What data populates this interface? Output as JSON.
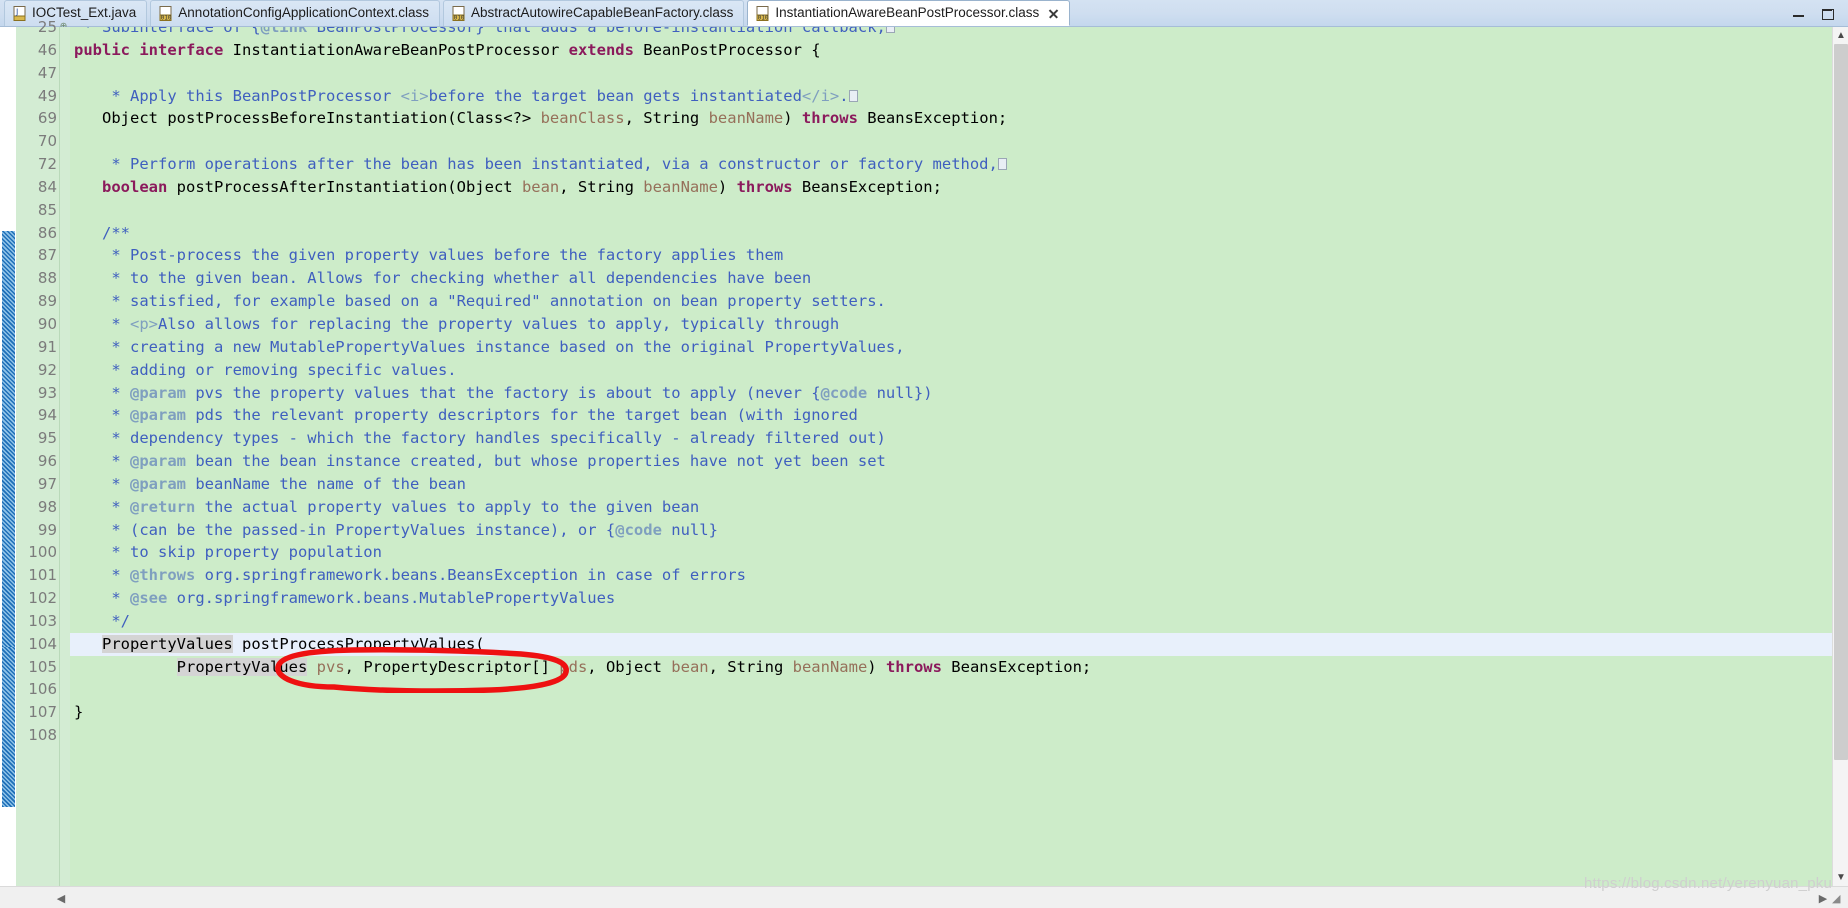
{
  "window": {
    "minimize_label": "Minimize",
    "maximize_label": "Maximize"
  },
  "tabs": [
    {
      "label": "IOCTest_Ext.java",
      "icon": "java-file-icon",
      "active": false,
      "closable": false
    },
    {
      "label": "AnnotationConfigApplicationContext.class",
      "icon": "class-file-icon",
      "active": false,
      "closable": false
    },
    {
      "label": "AbstractAutowireCapableBeanFactory.class",
      "icon": "class-file-icon",
      "active": false,
      "closable": false
    },
    {
      "label": "InstantiationAwareBeanPostProcessor.class",
      "icon": "class-file-icon",
      "active": true,
      "closable": true
    }
  ],
  "editor": {
    "file": "InstantiationAwareBeanPostProcessor.class",
    "current_line": 104,
    "lines": [
      {
        "num": "25",
        "fold": "collapsed",
        "clipped": true
      },
      {
        "num": "46",
        "fold": ""
      },
      {
        "num": "47",
        "fold": ""
      },
      {
        "num": "49",
        "fold": "collapsed"
      },
      {
        "num": "69",
        "fold": ""
      },
      {
        "num": "70",
        "fold": ""
      },
      {
        "num": "72",
        "fold": "collapsed"
      },
      {
        "num": "84",
        "fold": ""
      },
      {
        "num": "85",
        "fold": ""
      },
      {
        "num": "86",
        "fold": "expanded"
      },
      {
        "num": "87",
        "fold": ""
      },
      {
        "num": "88",
        "fold": ""
      },
      {
        "num": "89",
        "fold": ""
      },
      {
        "num": "90",
        "fold": ""
      },
      {
        "num": "91",
        "fold": ""
      },
      {
        "num": "92",
        "fold": ""
      },
      {
        "num": "93",
        "fold": ""
      },
      {
        "num": "94",
        "fold": ""
      },
      {
        "num": "95",
        "fold": ""
      },
      {
        "num": "96",
        "fold": ""
      },
      {
        "num": "97",
        "fold": ""
      },
      {
        "num": "98",
        "fold": ""
      },
      {
        "num": "99",
        "fold": ""
      },
      {
        "num": "100",
        "fold": ""
      },
      {
        "num": "101",
        "fold": ""
      },
      {
        "num": "102",
        "fold": ""
      },
      {
        "num": "103",
        "fold": ""
      },
      {
        "num": "104",
        "fold": "expanded",
        "current": true
      },
      {
        "num": "105",
        "fold": ""
      },
      {
        "num": "106",
        "fold": ""
      },
      {
        "num": "107",
        "fold": ""
      },
      {
        "num": "108",
        "fold": ""
      }
    ],
    "source": [
      " * Subinterface of {@link BeanPostProcessor} that adds a before-instantiation callback,",
      "public interface InstantiationAwareBeanPostProcessor extends BeanPostProcessor {",
      "",
      "    * Apply this BeanPostProcessor <i>before the target bean gets instantiated</i>.",
      "   Object postProcessBeforeInstantiation(Class<?> beanClass, String beanName) throws BeansException;",
      "",
      "    * Perform operations after the bean has been instantiated, via a constructor or factory method,",
      "   boolean postProcessAfterInstantiation(Object bean, String beanName) throws BeansException;",
      "",
      "   /**",
      "    * Post-process the given property values before the factory applies them",
      "    * to the given bean. Allows for checking whether all dependencies have been",
      "    * satisfied, for example based on a \"Required\" annotation on bean property setters.",
      "    * <p>Also allows for replacing the property values to apply, typically through",
      "    * creating a new MutablePropertyValues instance based on the original PropertyValues,",
      "    * adding or removing specific values.",
      "    * @param pvs the property values that the factory is about to apply (never {@code null})",
      "    * @param pds the relevant property descriptors for the target bean (with ignored",
      "    * dependency types - which the factory handles specifically - already filtered out)",
      "    * @param bean the bean instance created, but whose properties have not yet been set",
      "    * @param beanName the name of the bean",
      "    * @return the actual property values to apply to the given bean",
      "    * (can be the passed-in PropertyValues instance), or {@code null}",
      "    * to skip property population",
      "    * @throws org.springframework.beans.BeansException in case of errors",
      "    * @see org.springframework.beans.MutablePropertyValues",
      "    */",
      "   PropertyValues postProcessPropertyValues(",
      "           PropertyValues pvs, PropertyDescriptor[] pds, Object bean, String beanName) throws BeansException;",
      "",
      "}",
      ""
    ]
  },
  "annotation": {
    "type": "hand-drawn-ellipse",
    "color": "#ee1111",
    "targets_text": "postProcessPropertyValues"
  },
  "colors": {
    "editor_background": "#cdecc9",
    "gutter_background": "#d3ecd3",
    "current_line": "#e8f0fb",
    "occurrence_highlight": "#d4d4d4",
    "keyword": "#8b1a5c",
    "javadoc": "#3f5fbf",
    "javadoc_tag": "#7f9fbf",
    "parameter": "#96705a",
    "annotation_red": "#ee1111",
    "tab_active": "#ffffff",
    "tab_bar": "#cfdef0"
  },
  "scrollbars": {
    "vertical_up": "▲",
    "vertical_down": "▼",
    "horizontal_left": "◀",
    "horizontal_right": "▶"
  },
  "watermark": {
    "text": "https://blog.csdn.net/yerenyuan_pku"
  }
}
